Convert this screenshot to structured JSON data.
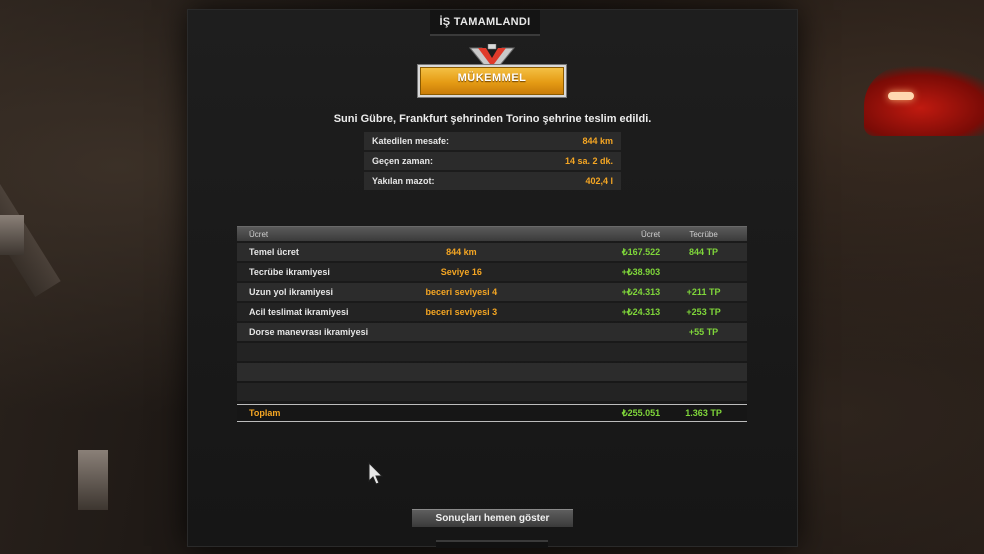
{
  "window": {
    "title": "İŞ TAMAMLANDI"
  },
  "rank": {
    "label": "MÜKEMMEL",
    "icon": "rank-emblem-icon",
    "bar_color": "#e59b14"
  },
  "delivery": {
    "description": "Suni Gübre, Frankfurt şehrinden Torino şehrine teslim edildi."
  },
  "stats": [
    {
      "label": "Katedilen mesafe:",
      "value": "844 km"
    },
    {
      "label": "Geçen zaman:",
      "value": "14 sa. 2 dk."
    },
    {
      "label": "Yakılan mazot:",
      "value": "402,4 l"
    }
  ],
  "table": {
    "headers": {
      "name": "Ücret",
      "detail": "",
      "income": "Ücret",
      "xp": "Tecrübe"
    },
    "rows": [
      {
        "name": "Temel ücret",
        "detail": "844 km",
        "income": "₺167.522",
        "xp": "844 TP"
      },
      {
        "name": "Tecrübe ikramiyesi",
        "detail": "Seviye 16",
        "income": "+₺38.903",
        "xp": ""
      },
      {
        "name": "Uzun yol ikramiyesi",
        "detail": "beceri seviyesi 4",
        "income": "+₺24.313",
        "xp": "+211 TP"
      },
      {
        "name": "Acil teslimat ikramiyesi",
        "detail": "beceri seviyesi 3",
        "income": "+₺24.313",
        "xp": "+253 TP"
      },
      {
        "name": "Dorse manevrası ikramiyesi",
        "detail": "",
        "income": "",
        "xp": "+55 TP"
      }
    ],
    "total": {
      "name": "Toplam",
      "income": "₺255.051",
      "xp": "1.363 TP"
    }
  },
  "actions": {
    "show_results_label": "Sonuçları hemen göster"
  },
  "colors": {
    "accent": "#f5a623",
    "positive": "#7fd63a",
    "text": "#e6e6e6"
  }
}
